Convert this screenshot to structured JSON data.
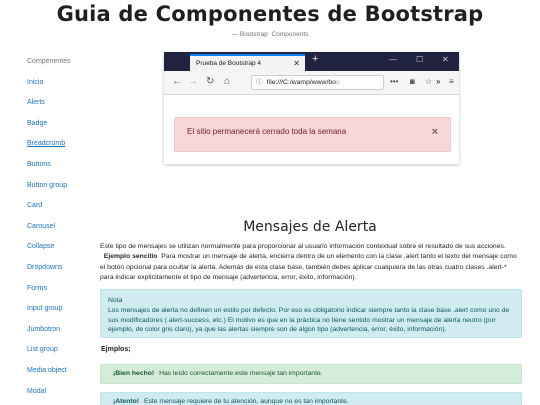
{
  "header": {
    "title": "Guia de Componentes de Bootstrap",
    "breadcrumb": [
      "— Bootstrap",
      "Components"
    ]
  },
  "sidebar": {
    "heading": "Compenentes",
    "items": [
      "Inicio",
      "Alerts",
      "Badge",
      "Breadcrumb",
      "Buttons",
      "Button group",
      "Card",
      "Carousel",
      "Collapse",
      "Dropdowns",
      "Forms",
      "Input group",
      "Jumbotron",
      "List group",
      "Media object",
      "Modal"
    ]
  },
  "browser": {
    "tab_title": "Prueba de Bootstrap 4",
    "url": "file:///C:/wamp/www/bo",
    "url_dim": "o",
    "alert_text": "El sitio permanecerá cerrado toda la semana"
  },
  "main": {
    "section_title": "Mensajes de Alerta",
    "desc_1": "Este tipo de mensajes se utilizan normalmente para proporcionar al usuario información contextual sobre el resultado de sus acciones.",
    "desc_bold": "Ejemplo sencillo",
    "desc_2": "Para mostrar un mensaje de alerta, encierra dentro de un elemento con la clase .alert tanto el texto del mensaje como el botón opcional para ocultar la alerta. Además de esta clase base, también debes aplicar cualquiera de las otras cuatro clases .alert-* para indicar explícitamente el tipo de mensaje (advertencia, error, éxito, información).",
    "note_title": "Nota",
    "note_text": "Los mensajes de alerta no definen un estilo por defecto. Por eso es obligatorio indicar siempre tanto la clase base .alert como uno de sus modificadores (.alert-success, etc.) El motivo es que en la práctica no tiene sentido mostrar un mensaje de alerta neutro (por ejemplo, de color gris claro), ya que las alertas siempre son de algún tipo (advertencia, error, éxito, información).",
    "examples_label": "Ejmplos;",
    "success_bold": "¡Bien hecho!",
    "success_text": "Has leído correctamente este mensaje tan importante.",
    "info_bold": "¡Atento!",
    "info_text": "Este mensaje requiere de tu atención, aunque no es tan importante."
  },
  "colors": {
    "link": "#1a73c6",
    "danger_bg": "#f8d7da",
    "info_bg": "#d1ecf1",
    "success_bg": "#d4edda"
  }
}
